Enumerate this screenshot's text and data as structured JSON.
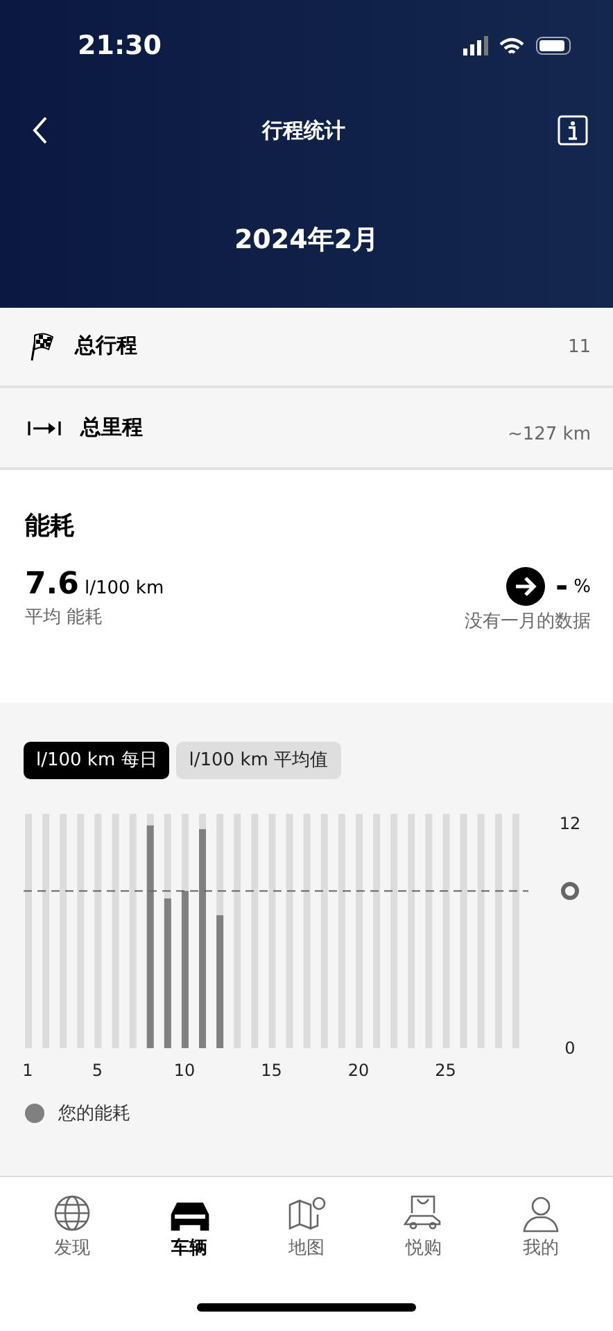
{
  "status_bar": {
    "time": "21:30"
  },
  "header": {
    "title": "行程统计",
    "period": "2024年2月"
  },
  "summary": [
    {
      "kind": "trips",
      "label": "总行程",
      "value": "11"
    },
    {
      "kind": "distance",
      "label": "总里程",
      "value": "~127 km"
    }
  ],
  "consumption": {
    "title": "能耗",
    "value": "7.6",
    "unit": "l/100 km",
    "caption": "平均 能耗",
    "change": "-",
    "change_unit": "%",
    "comparison": "没有一月的数据"
  },
  "chart_tabs": [
    {
      "label": "l/100 km 每日",
      "selected": true
    },
    {
      "label": "l/100 km 平均值",
      "selected": false
    }
  ],
  "chart_data": {
    "type": "bar",
    "x": [
      8,
      9,
      10,
      11,
      12
    ],
    "series": [
      {
        "name": "您的能耗",
        "color": "#808080",
        "values": [
          11.9,
          8.0,
          8.4,
          11.7,
          7.1
        ]
      }
    ],
    "xticks": [
      1,
      5,
      10,
      15,
      20,
      25
    ],
    "yticks": [
      0,
      12
    ],
    "ylim": [
      0,
      12
    ],
    "xlim": [
      1,
      29
    ],
    "grid": true,
    "ref_lines": [
      {
        "axis": "y",
        "value": 8.4
      }
    ]
  },
  "tab_bar": [
    {
      "kind": "globe",
      "label": "发现",
      "selected": false
    },
    {
      "kind": "car",
      "label": "车辆",
      "selected": true
    },
    {
      "kind": "map",
      "label": "地图",
      "selected": false
    },
    {
      "kind": "shop",
      "label": "悦购",
      "selected": false
    },
    {
      "kind": "person",
      "label": "我的",
      "selected": false
    }
  ]
}
